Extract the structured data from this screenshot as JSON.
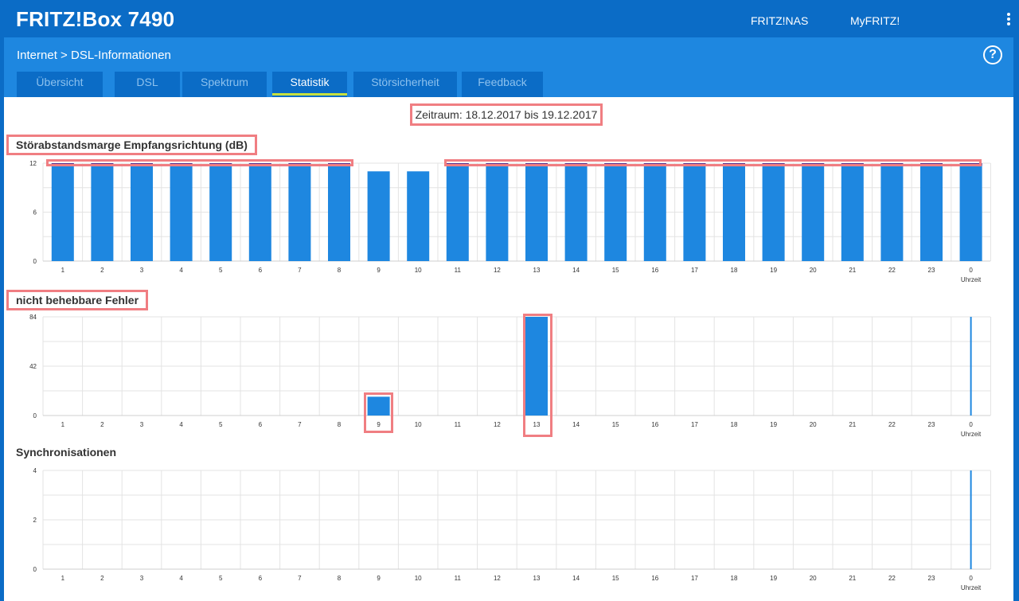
{
  "header": {
    "brand": "FRITZ!Box 7490",
    "links": [
      "FRITZ!NAS",
      "MyFRITZ!"
    ]
  },
  "breadcrumb": {
    "parent": "Internet",
    "separator": ">",
    "current": "DSL-Informationen"
  },
  "help_label": "?",
  "tabs": [
    {
      "label": "Übersicht",
      "active": false
    },
    {
      "label": "DSL",
      "active": false
    },
    {
      "label": "Spektrum",
      "active": false
    },
    {
      "label": "Statistik",
      "active": true
    },
    {
      "label": "Störsicherheit",
      "active": false
    },
    {
      "label": "Feedback",
      "active": false
    }
  ],
  "period": "Zeitraum: 18.12.2017 bis 19.12.2017",
  "colors": {
    "topbar": "#0b6cc6",
    "subbar": "#1e87e0",
    "bar": "#1e87e0",
    "bar_top": "#5b2f8c",
    "highlight": "#f07e82",
    "current_hour": "#b8d7f3"
  },
  "chart_data": [
    {
      "type": "bar",
      "title": "Störabstandsmarge Empfangsrichtung (dB)",
      "categories": [
        "1",
        "2",
        "3",
        "4",
        "5",
        "6",
        "7",
        "8",
        "9",
        "10",
        "11",
        "12",
        "13",
        "14",
        "15",
        "16",
        "17",
        "18",
        "19",
        "20",
        "21",
        "22",
        "23",
        "0"
      ],
      "values": [
        12,
        12,
        12,
        12,
        12,
        12,
        12,
        12,
        11,
        11,
        12,
        12,
        12,
        12,
        12,
        12,
        12,
        12,
        12,
        12,
        12,
        12,
        12,
        12
      ],
      "yticks": [
        0,
        6,
        12
      ],
      "ylim": [
        0,
        12
      ],
      "xlabel": "Uhrzeit",
      "grid": true
    },
    {
      "type": "bar",
      "title": "nicht behebbare Fehler",
      "categories": [
        "1",
        "2",
        "3",
        "4",
        "5",
        "6",
        "7",
        "8",
        "9",
        "10",
        "11",
        "12",
        "13",
        "14",
        "15",
        "16",
        "17",
        "18",
        "19",
        "20",
        "21",
        "22",
        "23",
        "0"
      ],
      "values": [
        0,
        0,
        0,
        0,
        0,
        0,
        0,
        0,
        16,
        0,
        0,
        0,
        84,
        0,
        0,
        0,
        0,
        0,
        0,
        0,
        0,
        0,
        0,
        0
      ],
      "yticks": [
        0,
        42,
        84
      ],
      "ylim": [
        0,
        84
      ],
      "xlabel": "Uhrzeit",
      "grid": true
    },
    {
      "type": "bar",
      "title": "Synchronisationen",
      "categories": [
        "1",
        "2",
        "3",
        "4",
        "5",
        "6",
        "7",
        "8",
        "9",
        "10",
        "11",
        "12",
        "13",
        "14",
        "15",
        "16",
        "17",
        "18",
        "19",
        "20",
        "21",
        "22",
        "23",
        "0"
      ],
      "values": [
        0,
        0,
        0,
        0,
        0,
        0,
        0,
        0,
        0,
        0,
        0,
        0,
        0,
        0,
        0,
        0,
        0,
        0,
        0,
        0,
        0,
        0,
        0,
        0
      ],
      "yticks": [
        0,
        2,
        4
      ],
      "ylim": [
        0,
        4
      ],
      "xlabel": "Uhrzeit",
      "grid": true
    }
  ]
}
